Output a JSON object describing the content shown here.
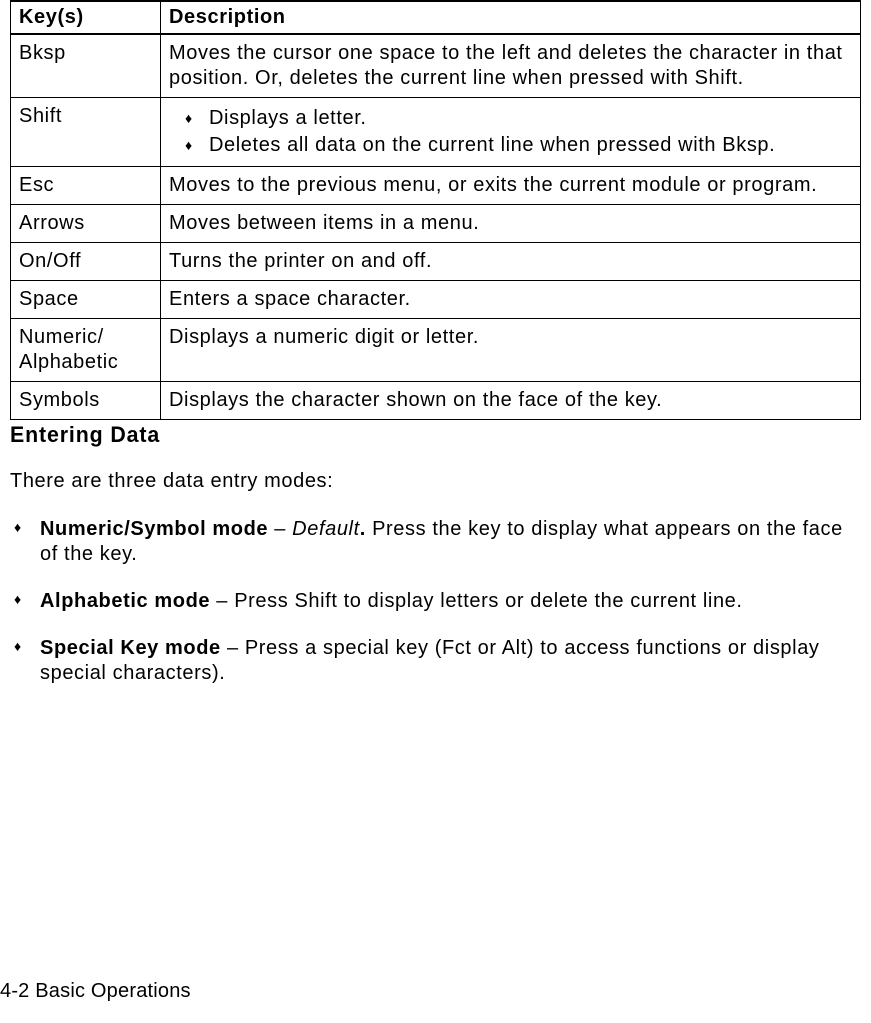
{
  "table": {
    "head_key": "Key(s)",
    "head_desc": "Description",
    "rows": {
      "bksp": {
        "key": "Bksp",
        "desc": "Moves the cursor one space to the left and deletes the character in that position.  Or, deletes the current line when pressed with Shift."
      },
      "shift": {
        "key": "Shift",
        "bul1": "Displays a letter.",
        "bul2": "Deletes all data on the current line when pressed with Bksp."
      },
      "esc": {
        "key": "Esc",
        "desc": "Moves to the previous menu, or exits the current module or program."
      },
      "arrows": {
        "key": "Arrows",
        "desc": "Moves between items in a menu."
      },
      "onoff": {
        "key": "On/Off",
        "desc": "Turns the printer on and off."
      },
      "space": {
        "key": "Space",
        "desc": "Enters a space character."
      },
      "numalpha": {
        "key_l1": "Numeric/",
        "key_l2": "Alphabetic",
        "desc": "Displays a numeric digit or letter."
      },
      "symbols": {
        "key": "Symbols",
        "desc": "Displays the character shown on the face of the key."
      }
    }
  },
  "section_title": "Entering Data",
  "lead": "There are three data entry modes:",
  "modes": {
    "m1": {
      "name": "Numeric/Symbol mode",
      "sep": " – ",
      "em": "Default",
      "punct": ".",
      "rest": "  Press the key to display what appears on the face of the key."
    },
    "m2": {
      "name": "Alphabetic mode",
      "sep": " – ",
      "rest": "Press Shift to display letters or delete the current line."
    },
    "m3": {
      "name": "Special Key mode",
      "sep": " – ",
      "rest": "Press a special key (Fct or Alt) to access functions or display special characters)."
    }
  },
  "footer": "4-2  Basic Operations"
}
